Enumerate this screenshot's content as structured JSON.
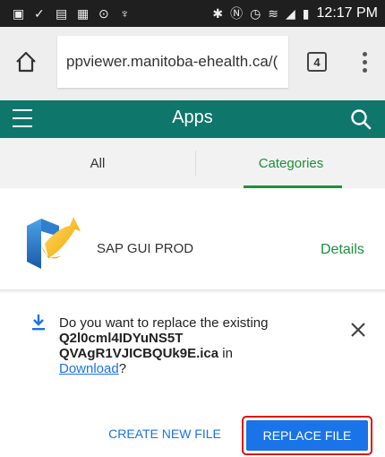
{
  "status_bar": {
    "time": "12:17 PM",
    "left_icons": [
      "gallery-icon",
      "check-icon",
      "image-icon",
      "chat-icon",
      "voicemail-icon",
      "usb-icon"
    ],
    "right_icons": [
      "bluetooth-icon",
      "nfc-icon",
      "alarm-icon",
      "wifi-icon",
      "signal-icon",
      "battery-icon"
    ]
  },
  "browser": {
    "url": "ppviewer.manitoba-ehealth.ca/(",
    "tab_count": "4"
  },
  "app_header": {
    "title": "Apps",
    "color": "#0f766c"
  },
  "tabs": [
    {
      "label": "All",
      "selected": false
    },
    {
      "label": "Categories",
      "selected": true
    }
  ],
  "apps": [
    {
      "name": "SAP GUI PROD",
      "action": "Details"
    }
  ],
  "download_prompt": {
    "line_prefix": "Do you want to replace the existing",
    "filename": "Q2l0cml4IDYuNS5TQVAgR1VJICBQUk9E.ica",
    "filename_part1": "Q2l0cml4IDYuNS5T",
    "filename_part2": "QVAgR1VJICBQUk9E.ica",
    "in_word": "in",
    "folder": "Download",
    "suffix": "?",
    "create_label": "CREATE NEW FILE",
    "replace_label": "REPLACE FILE"
  },
  "colors": {
    "accent_green": "#1e8f3c",
    "link_blue": "#1a73e8",
    "highlight_red": "#e01010"
  }
}
